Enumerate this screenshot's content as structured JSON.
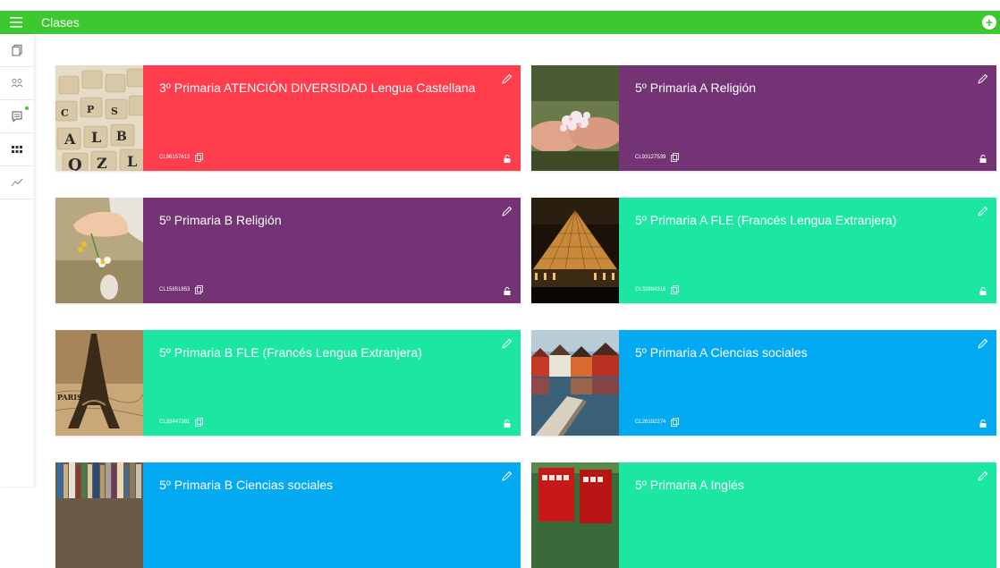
{
  "header": {
    "title": "Clases"
  },
  "sidebar": {
    "items": [
      {
        "icon": "copy-icon"
      },
      {
        "icon": "users-icon"
      },
      {
        "icon": "chat-icon",
        "badge": true
      },
      {
        "icon": "apps-grid-icon"
      },
      {
        "icon": "chart-icon"
      }
    ]
  },
  "colors": {
    "green": "#3cc82e",
    "red": "#ff3d4d",
    "purple": "#743375",
    "teal": "#1be6a2",
    "blue": "#03a9f1"
  },
  "classes": [
    {
      "name": "3º Primaria ATENCIÓN DIVERSIDAD Lengua Castellana",
      "code": "CL96157613",
      "color": "#ff3d4d",
      "image": "letter-dice-image"
    },
    {
      "name": "5º Primaria A Religión",
      "code": "CL93127539",
      "color": "#743375",
      "image": "flower-petals-hands-image"
    },
    {
      "name": "5º Primaria B Religión",
      "code": "CL15851853",
      "color": "#743375",
      "image": "child-hand-flower-image"
    },
    {
      "name": "5º Primaria A FLE (Francés Lengua Extranjera)",
      "code": "CL32884316",
      "color": "#1be6a2",
      "image": "louvre-pyramid-image"
    },
    {
      "name": "5º Primaria B FLE (Francés Lengua Extranjera)",
      "code": "CL33447381",
      "color": "#1be6a2",
      "image": "eiffel-tower-map-image"
    },
    {
      "name": "5º Primaria A Ciencias sociales",
      "code": "CL26192274",
      "color": "#03a9f1",
      "image": "colorful-harbor-houses-image"
    },
    {
      "name": "5º Primaria B Ciencias sociales",
      "code": "",
      "color": "#03a9f1",
      "image": "bookshelf-image"
    },
    {
      "name": "5º Primaria A Inglés",
      "code": "",
      "color": "#1be6a2",
      "image": "red-phone-booth-image"
    }
  ]
}
